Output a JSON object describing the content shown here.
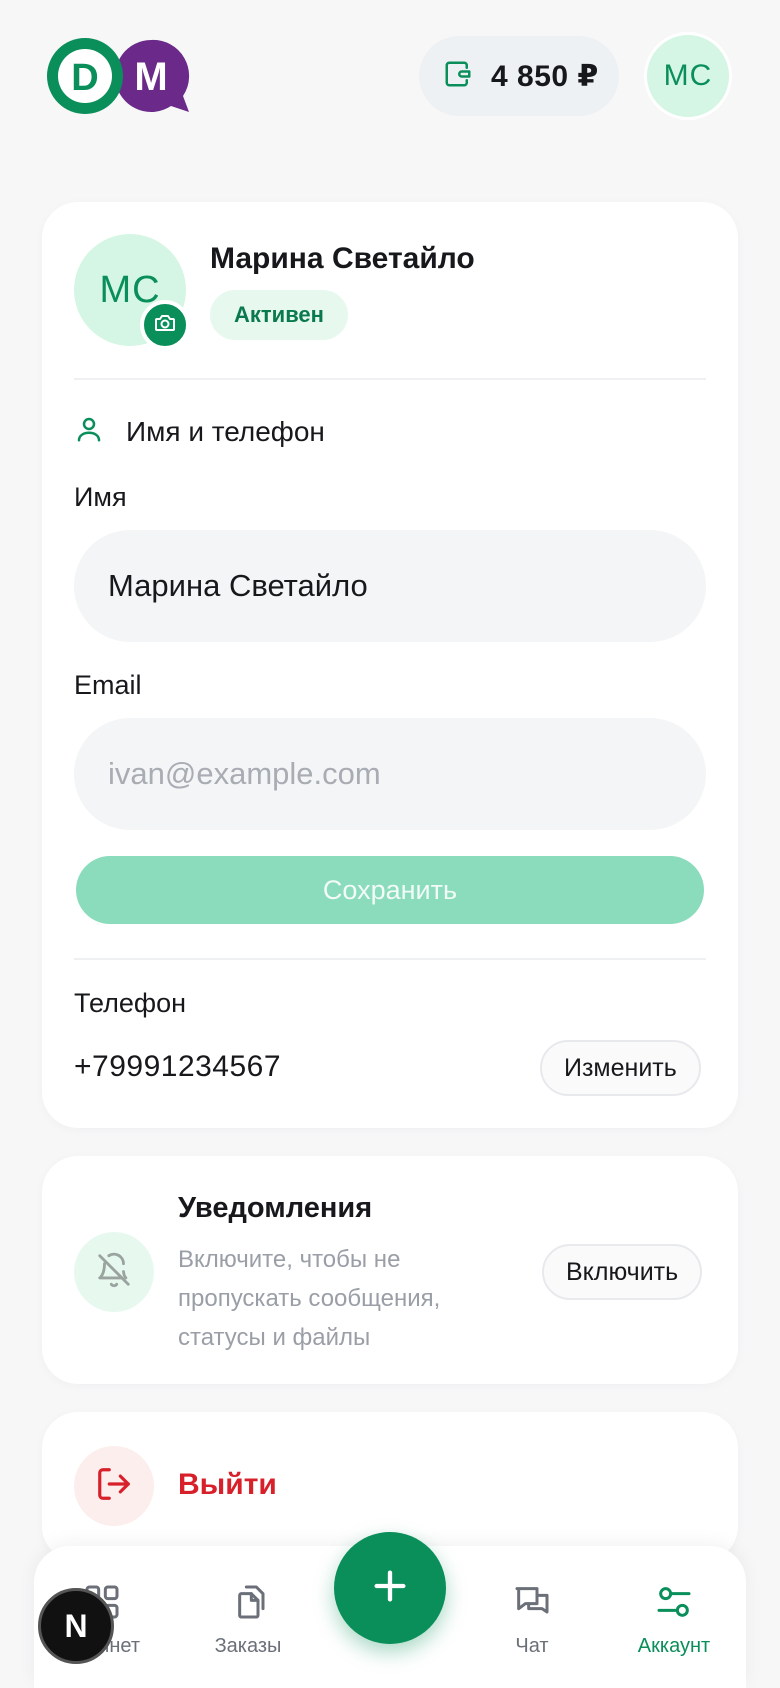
{
  "header": {
    "logo_text": "DM",
    "balance": "4 850 ₽",
    "avatar_initials": "MC"
  },
  "profile": {
    "avatar_initials": "MC",
    "name": "Марина Светайло",
    "status": "Активен",
    "section_title": "Имя и телефон",
    "name_label": "Имя",
    "name_value": "Марина Светайло",
    "email_label": "Email",
    "email_placeholder": "ivan@example.com",
    "save_label": "Сохранить",
    "phone_label": "Телефон",
    "phone_value": "+79991234567",
    "change_label": "Изменить"
  },
  "notifications": {
    "title": "Уведомления",
    "description": "Включите, чтобы не пропускать сообщения, статусы и файлы",
    "enable_label": "Включить"
  },
  "logout": {
    "label": "Выйти"
  },
  "nav": {
    "items": [
      {
        "label": "Кабинет",
        "icon": "grid-icon"
      },
      {
        "label": "Заказы",
        "icon": "documents-icon"
      },
      {
        "label": "Чат",
        "icon": "chat-icon"
      },
      {
        "label": "Аккаунт",
        "icon": "sliders-icon"
      }
    ],
    "active": "Аккаунт",
    "dev_badge": "N"
  },
  "colors": {
    "brand_green": "#0a8e5a",
    "brand_purple": "#6b2a8a",
    "danger_red": "#d8202a",
    "save_disabled": "#8adcbc"
  }
}
